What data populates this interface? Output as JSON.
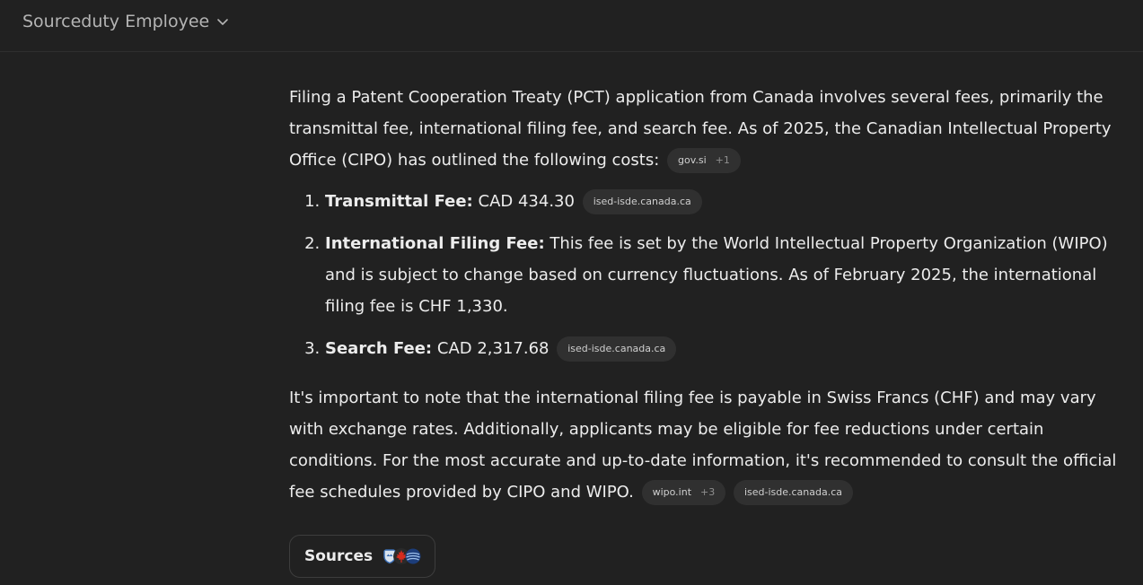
{
  "header": {
    "model_label": "Sourceduty Employee"
  },
  "message": {
    "intro": "Filing a Patent Cooperation Treaty (PCT) application from Canada involves several fees, primarily the transmittal fee, international filing fee, and search fee. As of 2025, the Canadian Intellectual Property Office (CIPO) has outlined the following costs:",
    "intro_citation": {
      "domain": "gov.si",
      "extra": "+1"
    },
    "items": [
      {
        "number": "1.",
        "label": "Transmittal Fee:",
        "text": "CAD 434.30",
        "citation": "ised-isde.canada.ca"
      },
      {
        "number": "2.",
        "label": "International Filing Fee:",
        "text": "This fee is set by the World Intellectual Property Organization (WIPO) and is subject to change based on currency fluctuations. As of February 2025, the international filing fee is CHF 1,330."
      },
      {
        "number": "3.",
        "label": "Search Fee:",
        "text": "CAD 2,317.68",
        "citation": "ised-isde.canada.ca"
      }
    ],
    "closing": "It's important to note that the international filing fee is payable in Swiss Francs (CHF) and may vary with exchange rates. Additionally, applicants may be eligible for fee reductions under certain conditions. For the most accurate and up-to-date information, it's recommended to consult the official fee schedules provided by CIPO and WIPO.",
    "closing_citations": [
      {
        "domain": "wipo.int",
        "extra": "+3"
      },
      {
        "domain": "ised-isde.canada.ca",
        "extra": ""
      }
    ]
  },
  "sources": {
    "label": "Sources",
    "icons": [
      "slovenia-shield-icon",
      "maple-leaf-icon",
      "globe-icon"
    ]
  }
}
